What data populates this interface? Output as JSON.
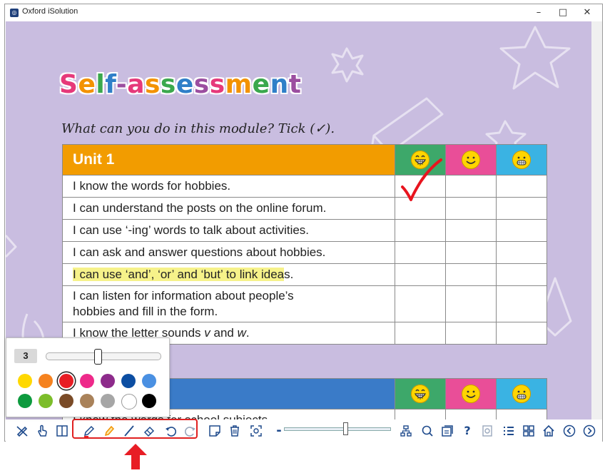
{
  "window": {
    "title": "Oxford iSolution",
    "minimize": "–",
    "maximize": "□",
    "close": "✕"
  },
  "page": {
    "heading_letters": [
      {
        "ch": "S",
        "color": "#e6397a"
      },
      {
        "ch": "e",
        "color": "#f39200"
      },
      {
        "ch": "l",
        "color": "#3aa84d"
      },
      {
        "ch": "f",
        "color": "#2f7fc8"
      },
      {
        "ch": "-",
        "color": "#9b4ea0"
      },
      {
        "ch": "a",
        "color": "#e6397a"
      },
      {
        "ch": "s",
        "color": "#f39200"
      },
      {
        "ch": "s",
        "color": "#3aa84d"
      },
      {
        "ch": "e",
        "color": "#2f7fc8"
      },
      {
        "ch": "s",
        "color": "#9b4ea0"
      },
      {
        "ch": "s",
        "color": "#e6397a"
      },
      {
        "ch": "m",
        "color": "#f39200"
      },
      {
        "ch": "e",
        "color": "#3aa84d"
      },
      {
        "ch": "n",
        "color": "#2f7fc8"
      },
      {
        "ch": "t",
        "color": "#9b4ea0"
      }
    ],
    "instruction": "What can you do in this module? Tick (✓).",
    "unit1": {
      "title": "Unit 1",
      "statements": [
        {
          "pre": "I know the words for hobbies.",
          "hl": "",
          "post": ""
        },
        {
          "pre": "I can understand the posts on the online forum.",
          "hl": "",
          "post": ""
        },
        {
          "pre": "I can use ‘-ing’ words to talk about activities.",
          "hl": "",
          "post": ""
        },
        {
          "pre": "I can ask and answer questions about hobbies.",
          "hl": "",
          "post": ""
        },
        {
          "pre": "",
          "hl": "I can use ‘and’, ‘or’ and ‘but’ to link idea",
          "post": "s."
        },
        {
          "pre": "I can listen for information about people’s",
          "line2": "hobbies and fill in the form.",
          "hl": "",
          "post": ""
        },
        {
          "pre": "I know the letter sounds ",
          "it1": "v",
          "mid": " and ",
          "it2": "w",
          "post": "."
        }
      ]
    },
    "unit2": {
      "title": "",
      "partial_row": "I know the words for school subjects."
    },
    "face_colors": [
      "#3da86a",
      "#e94e98",
      "#3ab3e3"
    ],
    "ticked": {
      "row": 1,
      "column": "grin"
    },
    "ink_color": "#e8141e"
  },
  "pen_panel": {
    "size_value": "3",
    "size_level": 0.45,
    "colors_row1": [
      "#ffd800",
      "#f5821f",
      "#e81d25",
      "#ee2a8a",
      "#8d2b8b",
      "#0c4ea2",
      "#4a90e2"
    ],
    "colors_row2": [
      "#0d9a3e",
      "#7cbd2a",
      "#7a4b27",
      "#a9825a",
      "#a6a6a6",
      "#ffffff",
      "#000000"
    ],
    "selected_color": "#e81d25"
  },
  "toolbar": {
    "zoom_out_label": "-",
    "help_label": "?",
    "zoom_level": 0.57,
    "highlighted_tools": [
      "pen",
      "highlighter",
      "line",
      "eraser",
      "undo",
      "redo"
    ]
  }
}
